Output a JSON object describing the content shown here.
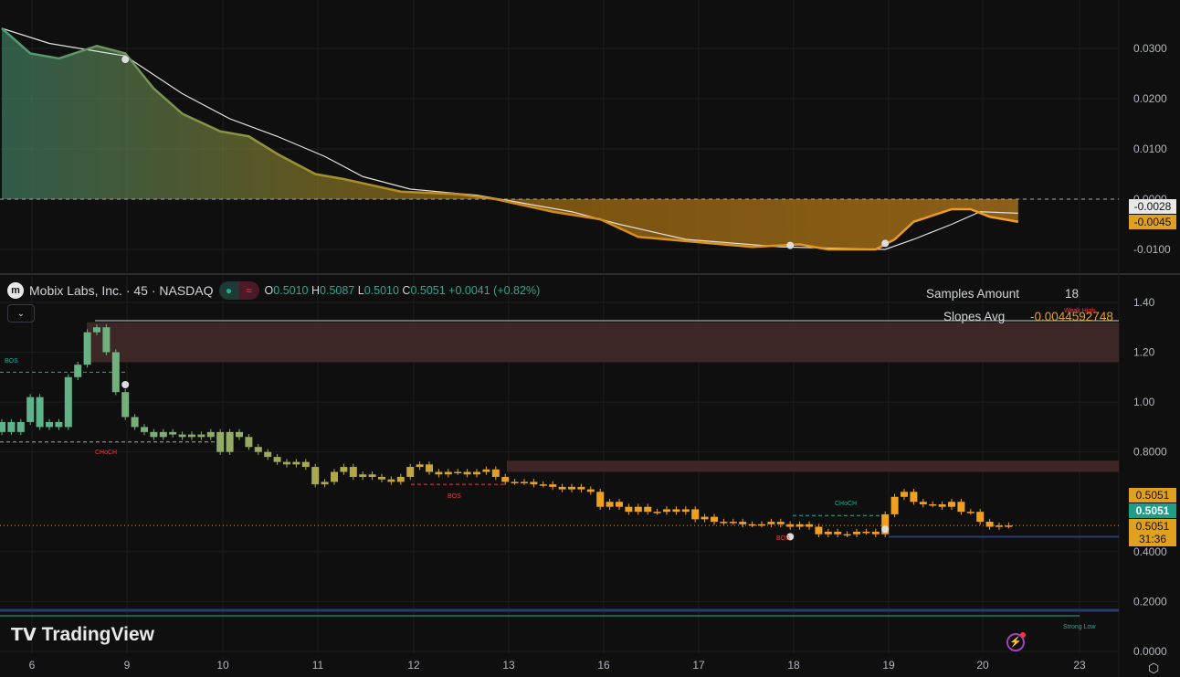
{
  "header": {
    "symbol": "Mobix Labs, Inc. · 45 · NASDAQ",
    "logo": "m",
    "open_label": "O",
    "open": "0.5010",
    "high_label": "H",
    "high": "0.5087",
    "low_label": "L",
    "low": "0.5010",
    "close_label": "C",
    "close": "0.5051",
    "change": "+0.0041 (+0.82%)"
  },
  "stats": {
    "samples_label": "Samples Amount",
    "samples_value": "18",
    "slopes_label": "Slopes Avg",
    "slopes_value": "-0.0044592748"
  },
  "brand": "TradingView",
  "annotations": {
    "bos1": "BOS",
    "choch1": "CHoCH",
    "bos2": "BOS",
    "choch2": "CHoCH",
    "bos3": "BOS",
    "weak_high": "Weak High",
    "strong_low": "Strong Low"
  },
  "tags": {
    "osc_white": "-0.0028",
    "osc_orange": "-0.0045",
    "price1": "0.5051",
    "price2": "0.5051",
    "price3": "0.5051",
    "countdown": "31:36"
  },
  "colors": {
    "up": "#5fb38a",
    "down": "#f0a020",
    "zone": "#3d2626",
    "blue": "#283a70",
    "teal": "#22ab94"
  },
  "chart_data": [
    {
      "type": "line",
      "title": "Oscillator",
      "yticks": [
        "0.0300",
        "0.0200",
        "0.0100",
        "0.0000",
        "-0.0100"
      ],
      "ytick_values": [
        0.03,
        0.02,
        0.01,
        0,
        -0.01
      ],
      "series": [
        {
          "name": "orange",
          "points": [
            [
              0,
              0.034
            ],
            [
              3,
              0.029
            ],
            [
              6,
              0.028
            ],
            [
              10,
              0.0305
            ],
            [
              13,
              0.029
            ],
            [
              16,
              0.022
            ],
            [
              19,
              0.017
            ],
            [
              23,
              0.0135
            ],
            [
              26,
              0.0125
            ],
            [
              29,
              0.009
            ],
            [
              33,
              0.005
            ],
            [
              36,
              0.004
            ],
            [
              42,
              0.0015
            ],
            [
              48,
              0.001
            ],
            [
              52,
              0
            ],
            [
              58,
              -0.0025
            ],
            [
              63,
              -0.004
            ],
            [
              67,
              -0.0075
            ],
            [
              73,
              -0.0085
            ],
            [
              79,
              -0.0095
            ],
            [
              84,
              -0.009
            ],
            [
              87,
              -0.01
            ],
            [
              92,
              -0.01
            ],
            [
              94,
              -0.008
            ],
            [
              96,
              -0.0045
            ],
            [
              100,
              -0.002
            ],
            [
              102,
              -0.002
            ],
            [
              104,
              -0.0035
            ],
            [
              107,
              -0.0045
            ]
          ]
        },
        {
          "name": "white",
          "points": [
            [
              0,
              0.034
            ],
            [
              5,
              0.031
            ],
            [
              13,
              0.0285
            ],
            [
              19,
              0.021
            ],
            [
              24,
              0.016
            ],
            [
              29,
              0.0125
            ],
            [
              34,
              0.0085
            ],
            [
              38,
              0.0045
            ],
            [
              43,
              0.002
            ],
            [
              50,
              0.0008
            ],
            [
              54,
              -0.0005
            ],
            [
              60,
              -0.0025
            ],
            [
              65,
              -0.005
            ],
            [
              72,
              -0.008
            ],
            [
              82,
              -0.0095
            ],
            [
              93,
              -0.01
            ],
            [
              96,
              -0.008
            ],
            [
              100,
              -0.005
            ],
            [
              103,
              -0.0025
            ],
            [
              107,
              -0.0028
            ]
          ]
        }
      ],
      "markers": [
        [
          13,
          0.0278
        ],
        [
          83,
          -0.0092
        ],
        [
          93,
          -0.0088
        ]
      ]
    },
    {
      "type": "candlestick",
      "title": "Mobix Labs, Inc. 45",
      "xticks": [
        "6",
        "9",
        "10",
        "11",
        "12",
        "13",
        "16",
        "17",
        "18",
        "19",
        "20",
        "23"
      ],
      "yticks": [
        "1.40",
        "1.20",
        "1.00",
        "0.8000",
        "0.4000",
        "0.2000",
        "0.0000"
      ],
      "ytick_values": [
        1.4,
        1.2,
        1.0,
        0.8,
        0.4,
        0.2,
        0
      ],
      "closes": [
        0.92,
        0.88,
        0.92,
        1.02,
        0.9,
        0.92,
        0.9,
        1.1,
        1.15,
        1.28,
        1.3,
        1.2,
        1.04,
        0.94,
        0.9,
        0.88,
        0.86,
        0.88,
        0.87,
        0.86,
        0.87,
        0.86,
        0.88,
        0.8,
        0.88,
        0.86,
        0.82,
        0.8,
        0.78,
        0.76,
        0.75,
        0.76,
        0.74,
        0.67,
        0.68,
        0.72,
        0.74,
        0.7,
        0.71,
        0.7,
        0.69,
        0.68,
        0.7,
        0.74,
        0.75,
        0.72,
        0.71,
        0.72,
        0.72,
        0.71,
        0.72,
        0.73,
        0.7,
        0.68,
        0.68,
        0.68,
        0.67,
        0.67,
        0.66,
        0.65,
        0.66,
        0.65,
        0.64,
        0.58,
        0.6,
        0.58,
        0.56,
        0.58,
        0.56,
        0.56,
        0.57,
        0.56,
        0.57,
        0.53,
        0.54,
        0.52,
        0.52,
        0.52,
        0.51,
        0.51,
        0.51,
        0.52,
        0.51,
        0.5,
        0.51,
        0.5,
        0.47,
        0.48,
        0.47,
        0.47,
        0.48,
        0.48,
        0.47,
        0.55,
        0.62,
        0.64,
        0.6,
        0.59,
        0.59,
        0.58,
        0.6,
        0.56,
        0.56,
        0.52,
        0.5,
        0.505,
        0.5051
      ],
      "first_open": 0.88,
      "last_price": 0.5051,
      "markers": [
        [
          13,
          1.07
        ],
        [
          83,
          0.46
        ],
        [
          93,
          0.49
        ]
      ],
      "zones": [
        [
          1.16,
          1.32
        ],
        [
          0.72,
          0.765
        ]
      ],
      "levels": {
        "bos1": 1.12,
        "choch1": 0.84,
        "bos2": 0.67,
        "choch2": 0.545,
        "blue1": 0.46,
        "blue2": 0.165,
        "strong_low": 0.143
      }
    }
  ]
}
